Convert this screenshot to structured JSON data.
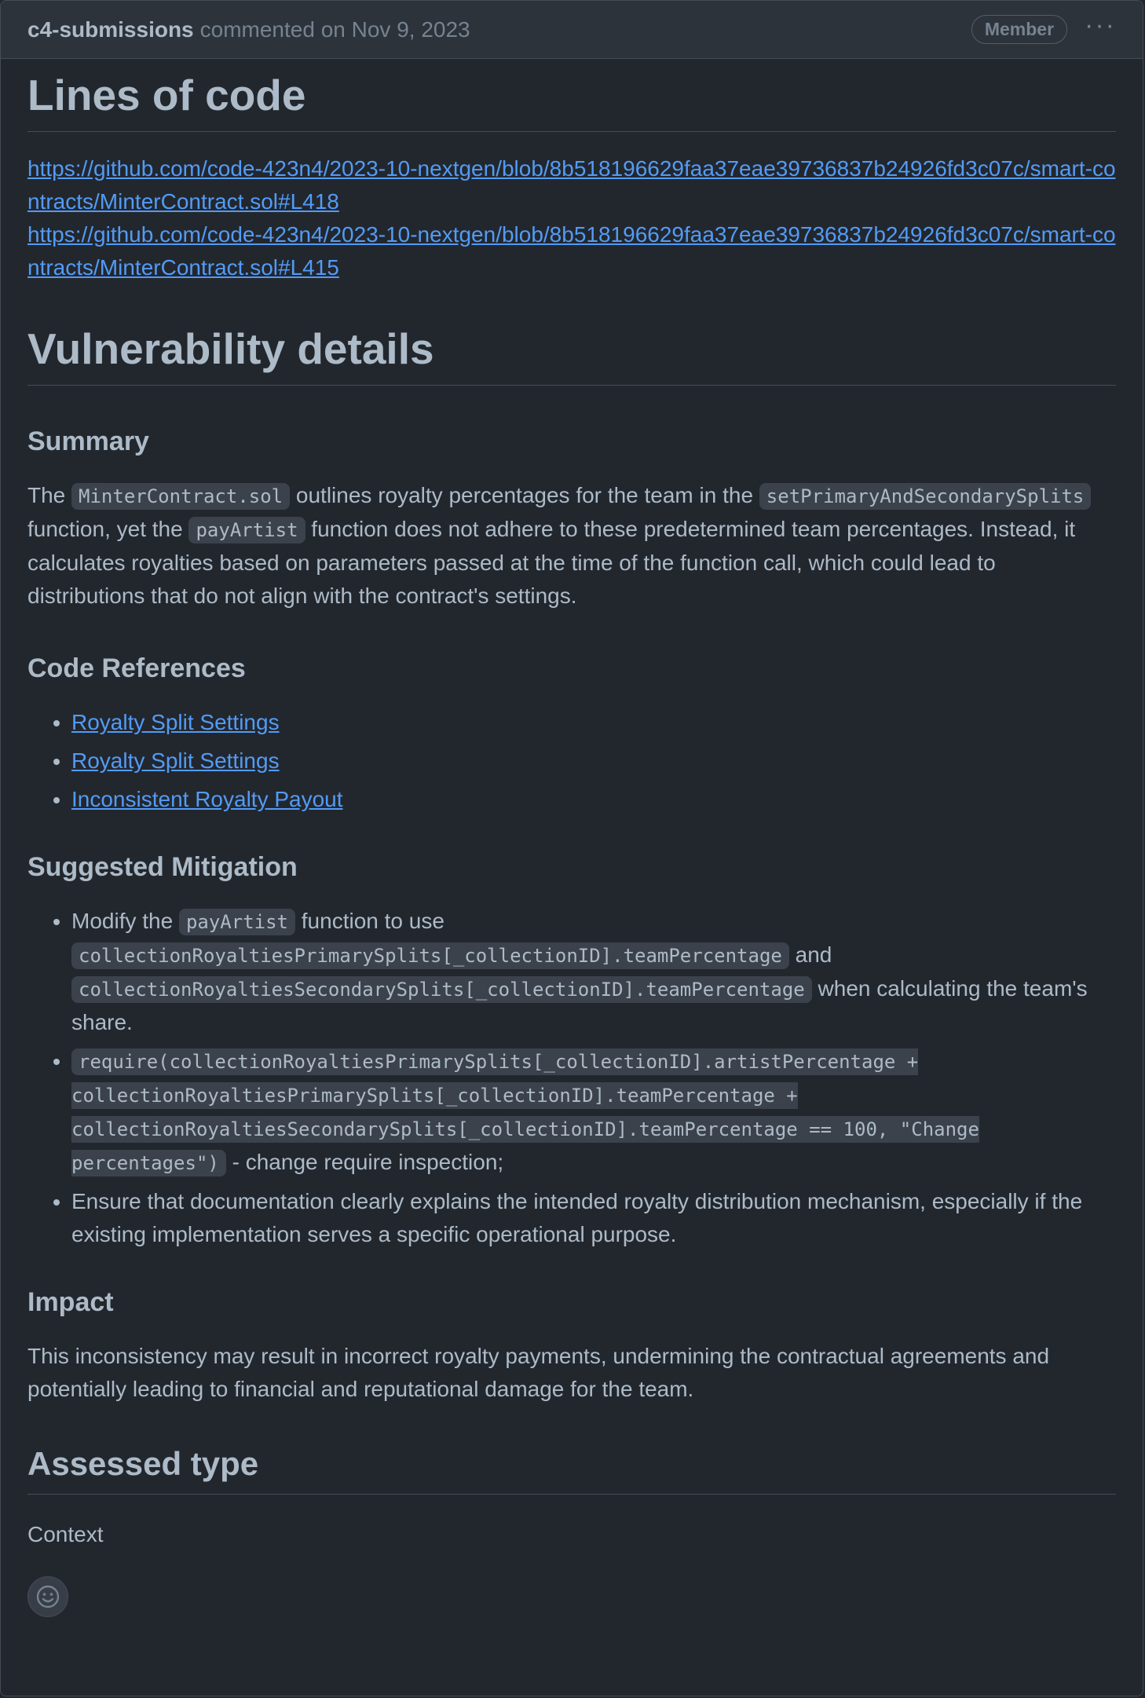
{
  "header": {
    "author": "c4-submissions",
    "meta": "commented on Nov 9, 2023",
    "badge": "Member",
    "more_icon": "kebab-horizontal-icon"
  },
  "sections": {
    "lines_of_code": {
      "title": "Lines of code",
      "links": [
        "https://github.com/code-423n4/2023-10-nextgen/blob/8b518196629faa37eae39736837b24926fd3c07c/smart-contracts/MinterContract.sol#L418",
        "https://github.com/code-423n4/2023-10-nextgen/blob/8b518196629faa37eae39736837b24926fd3c07c/smart-contracts/MinterContract.sol#L415"
      ]
    },
    "vuln": {
      "title": "Vulnerability details"
    },
    "summary": {
      "title": "Summary",
      "t1": "The ",
      "c1": "MinterContract.sol",
      "t2": " outlines royalty percentages for the team in the ",
      "c2": "setPrimaryAndSecondarySplits",
      "t3": " function, yet the ",
      "c3": "payArtist",
      "t4": " function does not adhere to these predetermined team percentages. Instead, it calculates royalties based on parameters passed at the time of the function call, which could lead to distributions that do not align with the contract's settings."
    },
    "code_refs": {
      "title": "Code References",
      "items": [
        "Royalty Split Settings",
        "Royalty Split Settings",
        "Inconsistent Royalty Payout"
      ]
    },
    "mitigation": {
      "title": "Suggested Mitigation",
      "i1_t1": "Modify the ",
      "i1_c1": "payArtist",
      "i1_t2": " function to use ",
      "i1_c2": "collectionRoyaltiesPrimarySplits[_collectionID].teamPercentage",
      "i1_t3": " and ",
      "i1_c3": "collectionRoyaltiesSecondarySplits[_collectionID].teamPercentage",
      "i1_t4": " when calculating the team's share.",
      "i2_c1": "require(collectionRoyaltiesPrimarySplits[_collectionID].artistPercentage + collectionRoyaltiesPrimarySplits[_collectionID].teamPercentage + collectionRoyaltiesSecondarySplits[_collectionID].teamPercentage == 100, \"Change percentages\")",
      "i2_t1": " - change require inspection;",
      "i3": "Ensure that documentation clearly explains the intended royalty distribution mechanism, especially if the existing implementation serves a specific operational purpose."
    },
    "impact": {
      "title": "Impact",
      "text": "This inconsistency may result in incorrect royalty payments, undermining the contractual agreements and potentially leading to financial and reputational damage for the team."
    },
    "assessed": {
      "title": "Assessed type",
      "value": "Context"
    }
  },
  "footer": {
    "reaction_icon": "smiley-icon"
  }
}
